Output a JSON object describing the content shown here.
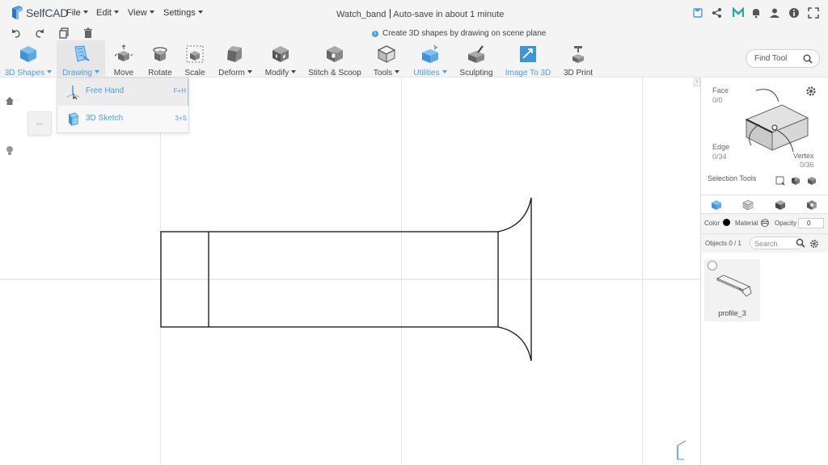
{
  "app": {
    "brand": "SelfCAD",
    "menus": [
      "File",
      "Edit",
      "View",
      "Settings"
    ],
    "doc_name": "Watch_band",
    "autosave": "Auto-save in about 1 minute"
  },
  "hint": "Create 3D shapes by drawing on scene plane",
  "toolbar": {
    "tools": [
      {
        "label": "3D Shapes",
        "dropdown": true
      },
      {
        "label": "Drawing",
        "dropdown": true
      },
      {
        "label": "Move",
        "dropdown": false
      },
      {
        "label": "Rotate",
        "dropdown": false
      },
      {
        "label": "Scale",
        "dropdown": false
      },
      {
        "label": "Deform",
        "dropdown": true
      },
      {
        "label": "Modify",
        "dropdown": true
      },
      {
        "label": "Stitch & Scoop",
        "dropdown": false
      },
      {
        "label": "Tools",
        "dropdown": true
      },
      {
        "label": "Utilities",
        "dropdown": true
      },
      {
        "label": "Sculpting",
        "dropdown": false
      },
      {
        "label": "Image To 3D",
        "dropdown": false
      },
      {
        "label": "3D Print",
        "dropdown": false
      }
    ],
    "find_tool": "Find Tool"
  },
  "drawing_menu": {
    "items": [
      {
        "label": "Free Hand",
        "shortcut": "F+H"
      },
      {
        "label": "3D Sketch",
        "shortcut": "3+S"
      }
    ]
  },
  "selection": {
    "face_label": "Face",
    "face_count": "0/0",
    "edge_label": "Edge",
    "edge_count": "0/34",
    "vertex_label": "Vertex",
    "vertex_count": "0/36",
    "tools_label": "Selection Tools"
  },
  "properties": {
    "color_label": "Color",
    "color_value": "#000000",
    "material_label": "Material",
    "opacity_label": "Opacity",
    "opacity_value": "0"
  },
  "objects": {
    "label": "Objects 0 / 1",
    "search_placeholder": "Search",
    "items": [
      {
        "name": "profile_3"
      }
    ]
  },
  "colors": {
    "accent": "#4a9fe0",
    "toolbar_bg": "#f4f4f4"
  },
  "icons": [
    "undo-icon",
    "redo-icon",
    "copy-icon",
    "trash-icon",
    "save-icon",
    "share-icon",
    "m-icon",
    "bell-icon",
    "user-icon",
    "info-icon",
    "fullscreen-icon",
    "home-icon",
    "light-icon",
    "gear-icon"
  ]
}
